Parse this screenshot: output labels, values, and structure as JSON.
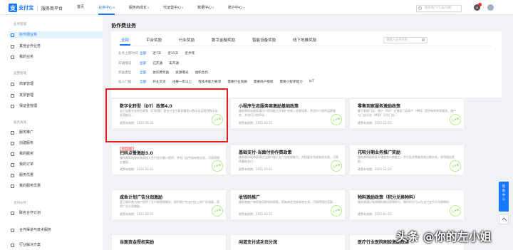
{
  "brand": {
    "logo_text": "支付宝",
    "name": "服务商平台"
  },
  "nav": {
    "items": [
      {
        "label": "首页"
      },
      {
        "label": "业务中心",
        "active": true
      },
      {
        "label": "服务商成长"
      },
      {
        "label": "代运营中心"
      },
      {
        "label": "数据中心"
      },
      {
        "label": "账户中心"
      }
    ]
  },
  "top_search": {
    "placeholder": "搜索商户/工具/功能"
  },
  "sidebar": {
    "groups": [
      {
        "title": "业务管理",
        "items": [
          {
            "label": "协作费业务",
            "active": true
          },
          {
            "label": "其他合作业务"
          },
          {
            "label": "我的业务"
          }
        ]
      },
      {
        "title": "运营管理",
        "items": [
          {
            "label": "商家管理"
          },
          {
            "label": "发票管理"
          },
          {
            "label": "保证金管理"
          }
        ]
      },
      {
        "title": "服务商城",
        "items": [
          {
            "label": "服务推广"
          },
          {
            "label": "创建服务"
          },
          {
            "label": "我的服务"
          },
          {
            "label": "我的订单"
          },
          {
            "label": "服务优惠"
          },
          {
            "label": "我的服务优惠"
          }
        ]
      },
      {
        "title": "合作伙伴",
        "items": [
          {
            "label": "联名合作计划"
          }
        ]
      },
      {
        "title": "",
        "items": [
          {
            "label": "合作渠道与技术服务"
          },
          {
            "label": "行业解决方案"
          }
        ]
      }
    ]
  },
  "main": {
    "title": "协作费业务",
    "tabs": [
      {
        "label": "全部",
        "active": true
      },
      {
        "label": "平台奖励"
      },
      {
        "label": "行业奖励"
      },
      {
        "label": "数字金融奖励"
      },
      {
        "label": "智能设备奖励"
      },
      {
        "label": "线下地推奖励"
      }
    ],
    "search_placeholder": "请输入业务名称",
    "filters": [
      {
        "label": "业务上新时间",
        "options": [
          "全部",
          "近7天",
          "近15天",
          "近半年"
        ],
        "selected": 0
      },
      {
        "label": "开通情况",
        "options": [
          "全部",
          "已开通",
          "未开通"
        ],
        "selected": 0
      },
      {
        "label": "奖励类型",
        "options": [
          "全部",
          "协作费奖励",
          "资源曝光",
          "组织合作"
        ],
        "selected": 0
      },
      {
        "label": "准入门槛",
        "options": [
          "全部",
          "开业交流",
          "注册一年以上",
          "有技术能力要求",
          "需要行业资质",
          "需要商户授权",
          "需要小程序能力",
          "IoT"
        ],
        "selected": 0
      }
    ],
    "cards": [
      {
        "title": "数字化转型（DT）政策4.0",
        "desc": "支付宝数字化转型政策（DT政策）是支付宝为帮助商家从数字化运营到数字化经营推出…",
        "date": "政策有效期：2021-06-30",
        "stamp": "已开通"
      },
      {
        "title": "小程序生态服务商激励基础政策",
        "desc": "服务商帮助商家通过小程序能力开发扩充线上经营场景，并进行小程序运营服务，并进行小程序化…",
        "date": "政策有效期：2021-03-31",
        "stamp": "已开通"
      },
      {
        "title": "零售到家服务激励政策",
        "desc": "基于到家门店，商户（ISV）在商家门店商户（MID）提供有效到家服务，商户与门店开启（MID）可在门店…",
        "date": "政策有效期：2021-12-31",
        "stamp": "已开通"
      },
      {
        "title": "扫码点餐激励3.0",
        "tag": "即将到期",
        "desc": "服务商帮助餐饮商家接入支付宝点餐小程序，并在门店完成有效交易，可获得相应激励…",
        "date": "政策有效期：2021-03-31",
        "stamp": "已开通"
      },
      {
        "title": "基础支付-当面付协作费政策",
        "desc": "服务商协助商家通过当面付接入支付宝收款能力，并按要求完成有效交易，可获得基础支付…",
        "date": "政策有效期：2021-03-31",
        "stamp": "已开通"
      },
      {
        "title": "花呗分期业务推广奖励",
        "desc": "服务商帮助商家开通花呗分期能力，并引导消费者完成分期交易，获得相应奖励…",
        "date": "政策有效期：2021-12-31",
        "stamp": "已开通"
      },
      {
        "title": "咸鱼计划广告分润激励",
        "desc": "基于服务商为商户提供了支付和营销服务，依托商户在支付宝上的广告流量，获得广告分润激励…",
        "date": "政策有效期：2021-03-31",
        "stamp": "已开通"
      },
      {
        "title": "收钱码推广",
        "desc": "服务商推广商家使用收钱码收款，帮助商家完成有效交易，可获得相应奖励…",
        "date": "政策有效期：2021-03-31",
        "stamp": "已开通"
      },
      {
        "title": "物料激励政策（积分兑换物料）",
        "desc": "服务商通过有效物料铺设获得积分，物料积分可以在支付宝平台兑换物料…",
        "date": "政策有效期：2021-03-31",
        "stamp": "已开通"
      },
      {
        "title": "当面资金授权奖励",
        "desc": "",
        "date": "",
        "stamp": ""
      },
      {
        "title": "闲道支付成功页分润",
        "desc": "",
        "date": "",
        "stamp": ""
      },
      {
        "title": "医疗行业医院刷脸激励政策",
        "desc": "",
        "date": "",
        "stamp": ""
      }
    ]
  },
  "float_button": {
    "label": "帮助中心"
  },
  "watermark": "头条 @你的左小姐",
  "colors": {
    "accent": "#1677ff",
    "highlight_border": "#e31f1f"
  }
}
